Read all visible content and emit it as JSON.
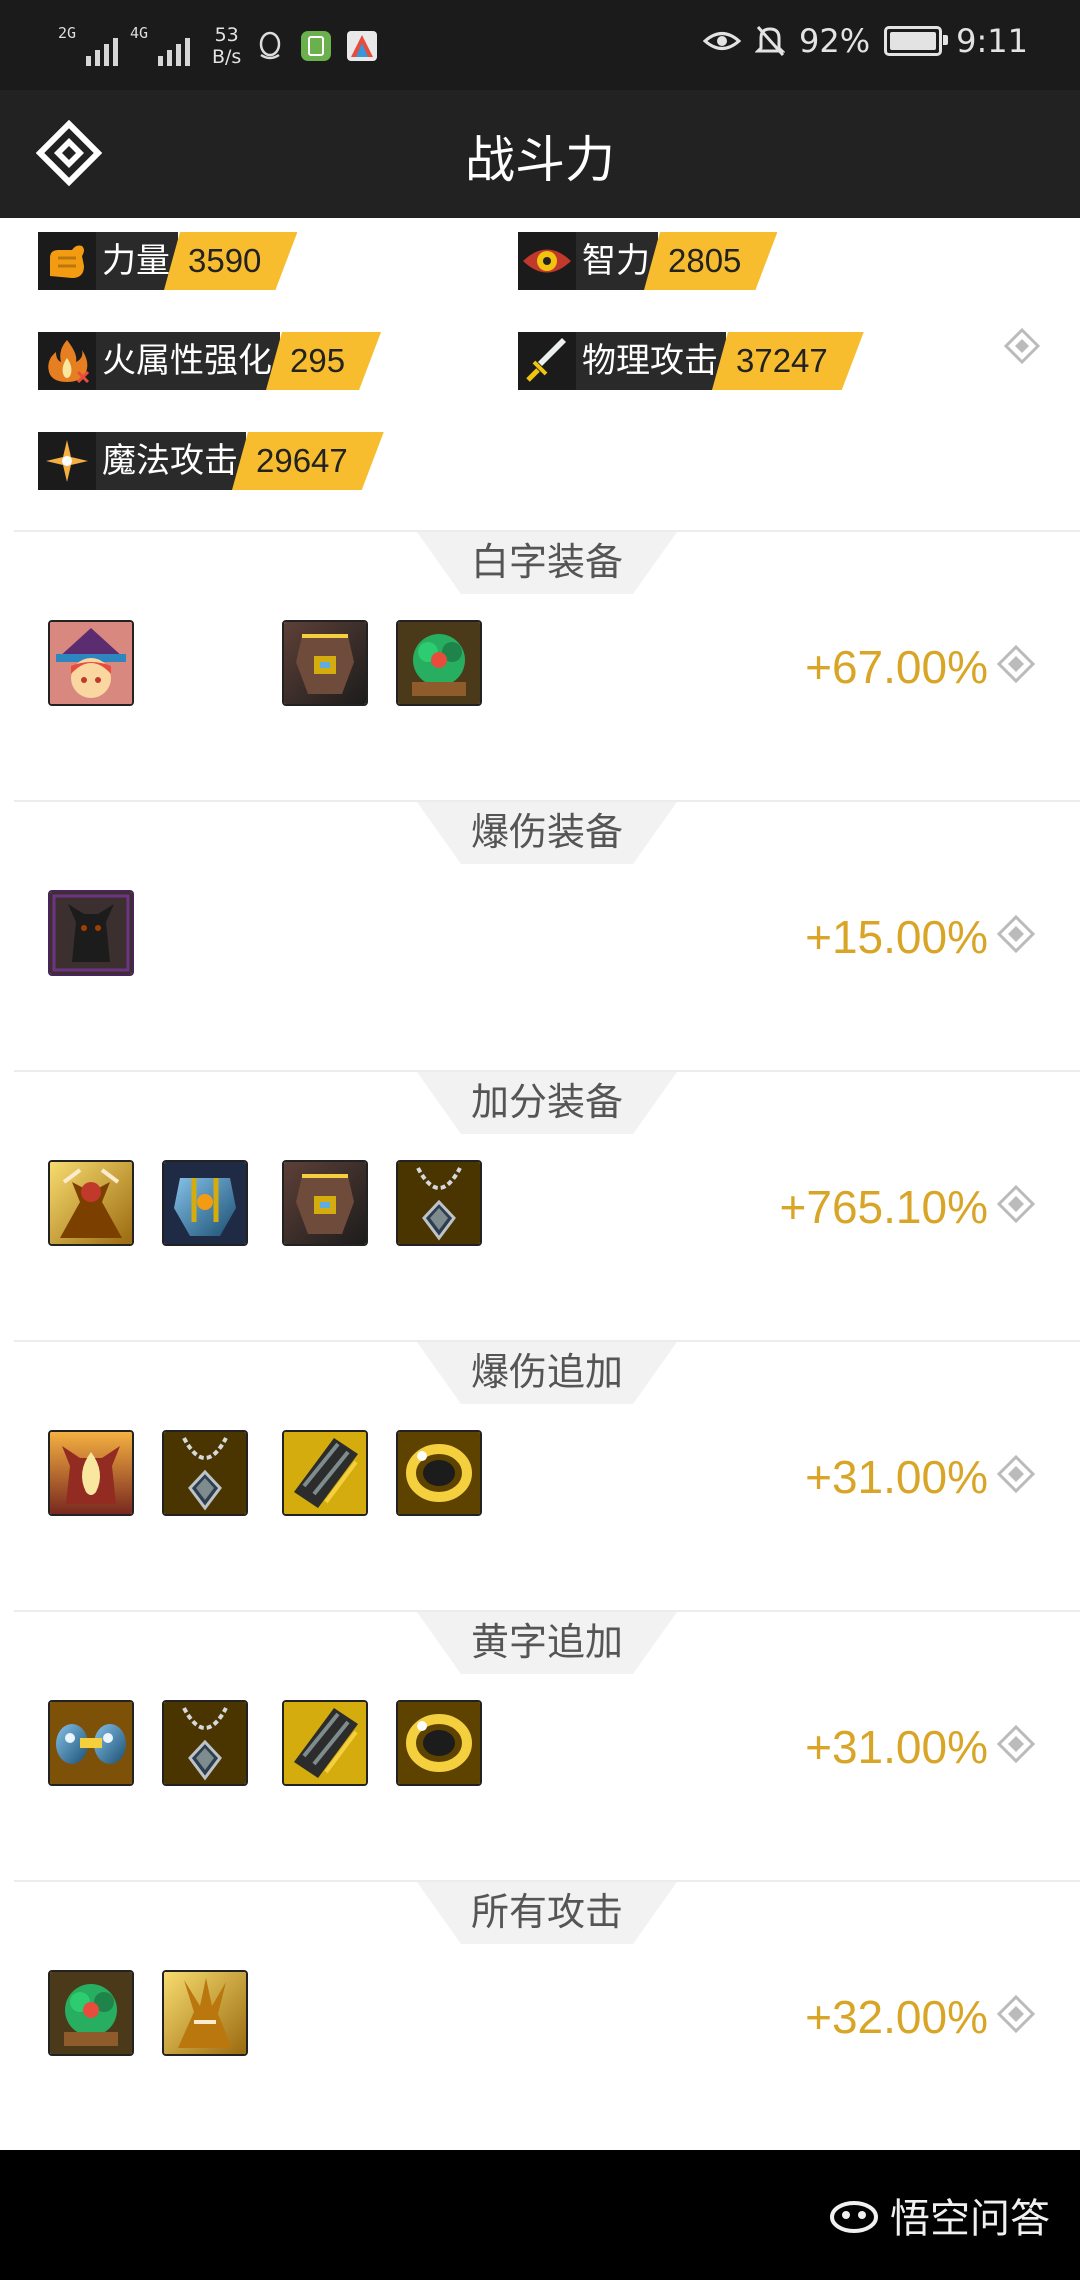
{
  "status_bar": {
    "signal_1_label": "2G",
    "signal_2_label": "4G",
    "speed_value": "53",
    "speed_unit": "B/s",
    "battery": "92%",
    "time": "9:11"
  },
  "header": {
    "title": "战斗力"
  },
  "stats": [
    {
      "icon": "fist-icon",
      "label": "力量",
      "value": "3590"
    },
    {
      "icon": "eye-icon",
      "label": "智力",
      "value": "2805"
    },
    {
      "icon": "fire-icon",
      "label": "火属性强化",
      "value": "295"
    },
    {
      "icon": "sword-icon",
      "label": "物理攻击",
      "value": "37247"
    },
    {
      "icon": "sparkle-icon",
      "label": "魔法攻击",
      "value": "29647"
    }
  ],
  "sections": [
    {
      "title": "白字装备",
      "value": "+67.00%",
      "items": [
        "hat-girl-item",
        "empty",
        "armor-item",
        "plant-item"
      ]
    },
    {
      "title": "爆伤装备",
      "value": "+15.00%",
      "items": [
        "dark-beast-item"
      ]
    },
    {
      "title": "加分装备",
      "value": "+765.10%",
      "items": [
        "golden-figure-item",
        "blue-armor-item",
        "armor-item",
        "necklace-item"
      ]
    },
    {
      "title": "爆伤追加",
      "value": "+31.00%",
      "items": [
        "fire-beast-item",
        "necklace-item",
        "bracer-item",
        "ring-item"
      ]
    },
    {
      "title": "黄字追加",
      "value": "+31.00%",
      "items": [
        "blue-crystal-item",
        "necklace-item",
        "bracer-item",
        "ring-item"
      ]
    },
    {
      "title": "所有攻击",
      "value": "+32.00%",
      "items": [
        "plant-item",
        "gold-claw-item"
      ]
    }
  ],
  "watermark": "悟空问答",
  "colors": {
    "accent": "#f7bd2f",
    "value_text": "#d9a526",
    "dark": "#222222"
  }
}
